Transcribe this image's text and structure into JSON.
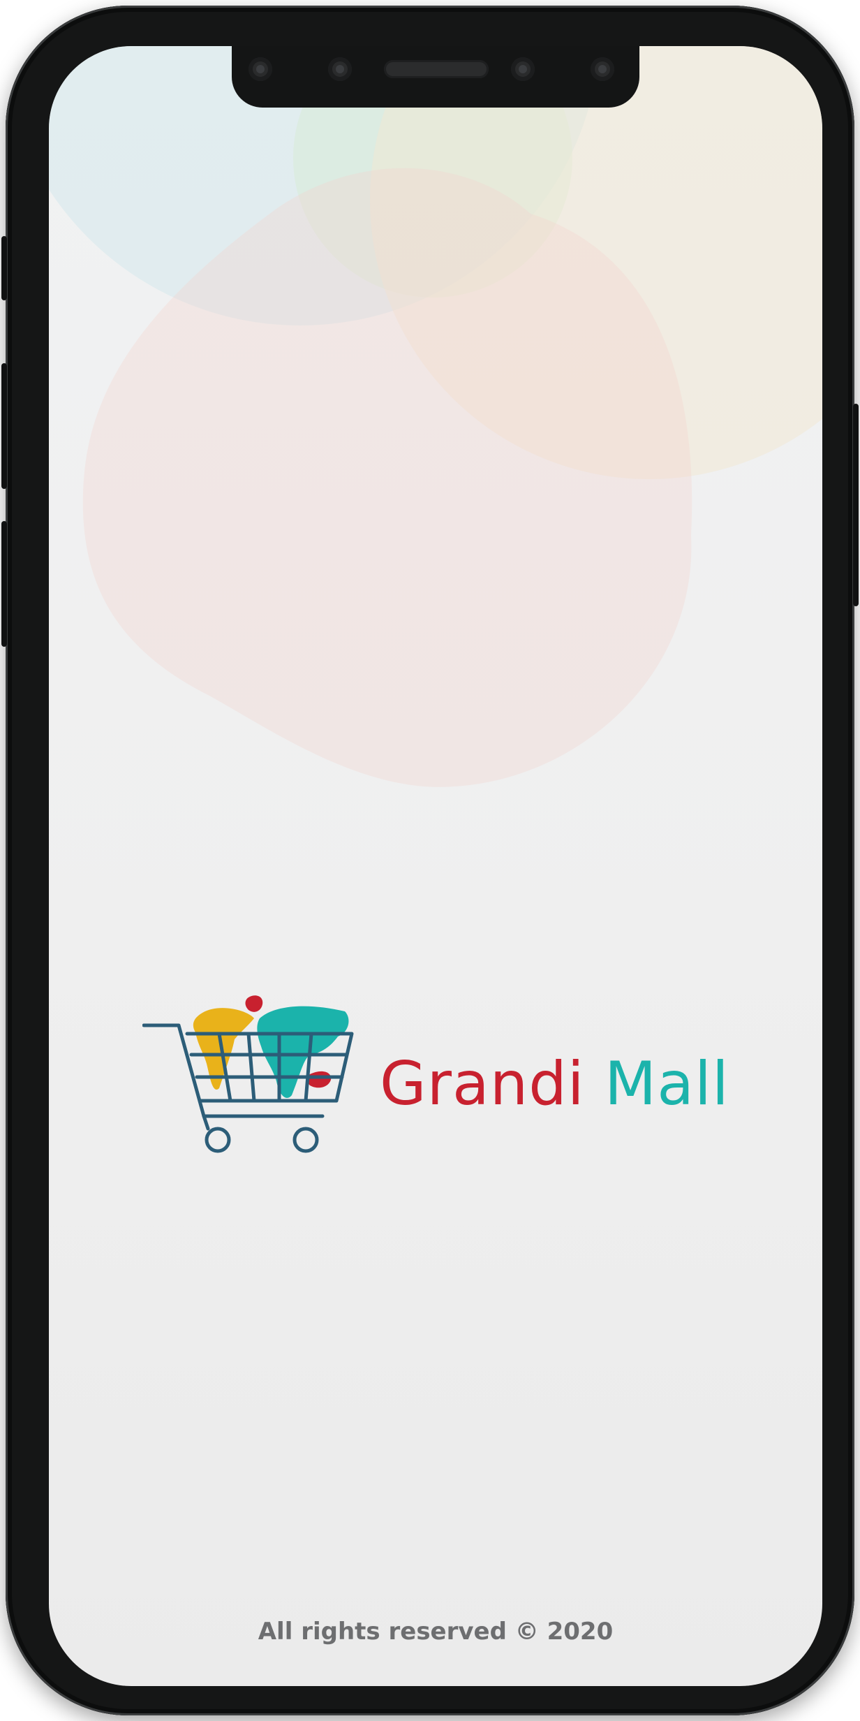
{
  "app": {
    "brand_part1": "Grandi",
    "brand_part2": "Mall",
    "footer": "All rights reserved © 2020"
  },
  "colors": {
    "brand_red": "#c8212f",
    "brand_teal": "#1bb3ab",
    "brand_yellow": "#e9b21a",
    "cart_blue": "#2c5d78"
  },
  "icons": {
    "logo": "shopping-cart-with-world-map-icon"
  }
}
